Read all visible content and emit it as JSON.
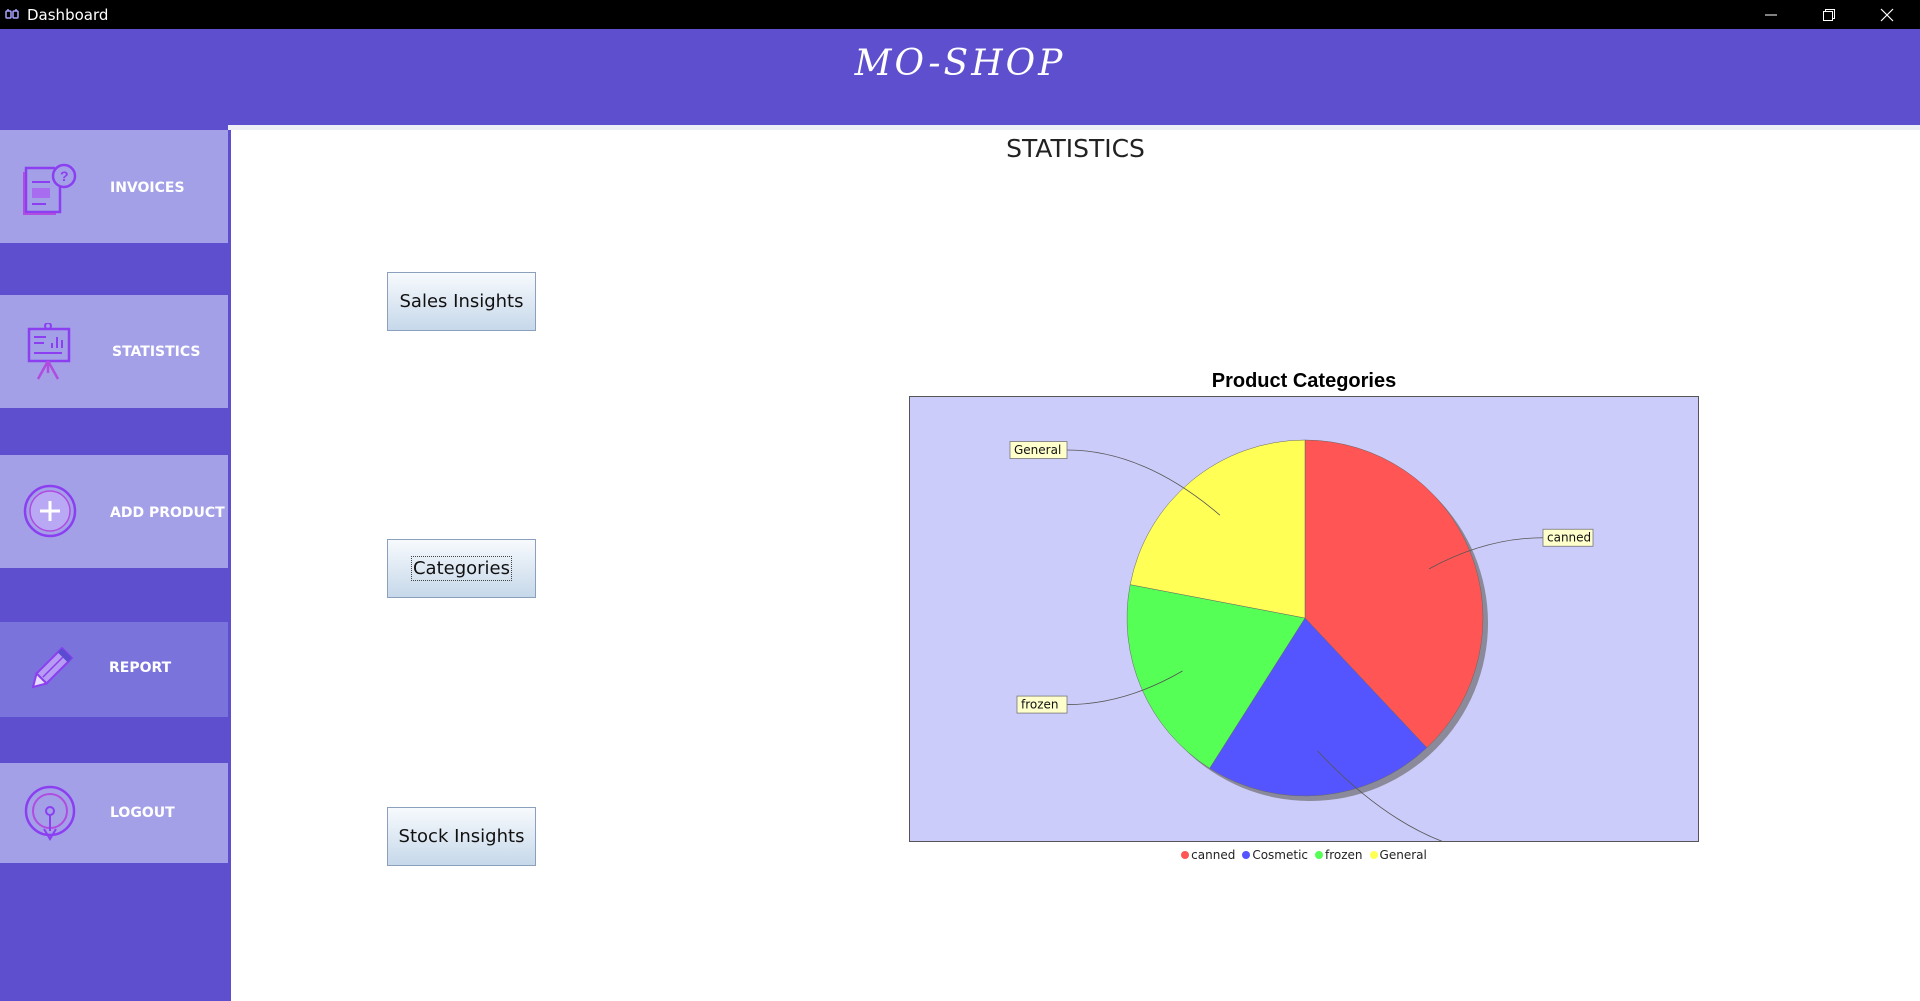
{
  "window": {
    "title": "Dashboard",
    "controls": [
      "minimize-icon",
      "restore-icon",
      "close-icon"
    ]
  },
  "header": {
    "brand": "MO-SHOP"
  },
  "sidebar": {
    "items": [
      {
        "label": "INVOICES",
        "icon": "invoice-icon"
      },
      {
        "label": "STATISTICS",
        "icon": "presentation-chart-icon"
      },
      {
        "label": "ADD PRODUCT",
        "icon": "add-circle-icon"
      },
      {
        "label": "REPORT",
        "icon": "pencil-icon"
      },
      {
        "label": "LOGOUT",
        "icon": "logout-icon"
      }
    ],
    "active_index": 3
  },
  "main": {
    "title": "STATISTICS",
    "buttons": [
      "Sales Insights",
      "Categories",
      "Stock Insights"
    ],
    "focused_button_index": 1
  },
  "colors": {
    "accent": "#5e4fce",
    "nav_item": "#a3a0e8",
    "nav_item_active": "#7a73dc",
    "plot_background": "#ccccfa"
  },
  "chart_data": {
    "type": "pie",
    "title": "Product Categories",
    "categories": [
      "canned",
      "Cosmetic",
      "frozen",
      "General"
    ],
    "values": [
      38,
      21,
      19,
      22
    ],
    "colors": [
      "#ff5555",
      "#5555ff",
      "#55ff55",
      "#ffff55"
    ],
    "legend_placement": "bottom",
    "labels_shown": true
  }
}
